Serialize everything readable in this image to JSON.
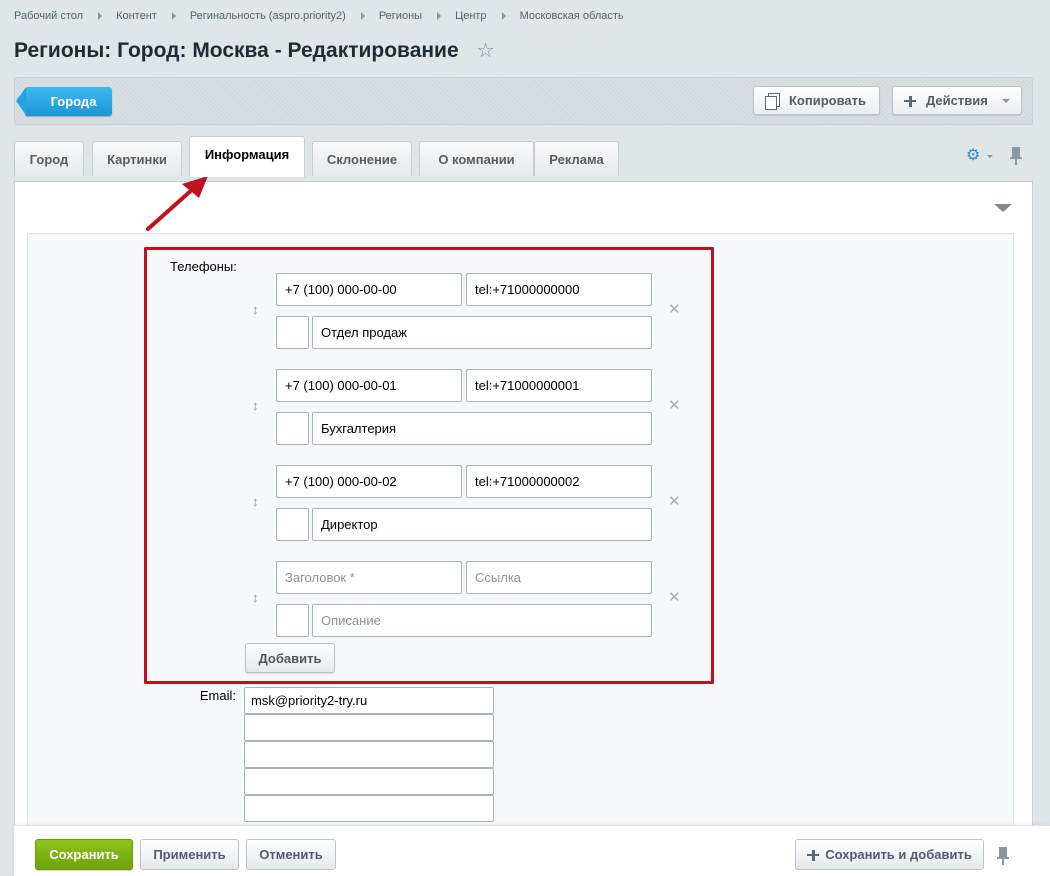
{
  "breadcrumb": [
    "Рабочий стол",
    "Контент",
    "Регинальность (aspro.priority2)",
    "Регионы",
    "Центр",
    "Московская область"
  ],
  "page_title": "Регионы: Город: Москва - Редактирование",
  "toolbar": {
    "back_label": "Города",
    "copy_label": "Копировать",
    "actions_label": "Действия"
  },
  "tabs": [
    "Город",
    "Картинки",
    "Информация",
    "Склонение",
    "О компании",
    "Реклама"
  ],
  "active_tab": "Информация",
  "form": {
    "phones_label": "Телефоны:",
    "phones": [
      {
        "number": "+7 (100) 000-00-00",
        "link": "tel:+71000000000",
        "description": "Отдел продаж"
      },
      {
        "number": "+7 (100) 000-00-01",
        "link": "tel:+71000000001",
        "description": "Бухгалтерия"
      },
      {
        "number": "+7 (100) 000-00-02",
        "link": "tel:+71000000002",
        "description": "Директор"
      }
    ],
    "new_phone": {
      "title_placeholder": "Заголовок *",
      "link_placeholder": "Ссылка",
      "description_placeholder": "Описание"
    },
    "add_label": "Добавить",
    "email_label": "Email:",
    "emails": [
      "msk@priority2-try.ru",
      "",
      "",
      "",
      ""
    ]
  },
  "footer": {
    "save_label": "Сохранить",
    "apply_label": "Применить",
    "cancel_label": "Отменить",
    "save_add_label": "Сохранить и добавить"
  },
  "colors": {
    "highlight": "#c0121c",
    "save_green": "#7bb213",
    "back_blue": "#27a3e0"
  }
}
